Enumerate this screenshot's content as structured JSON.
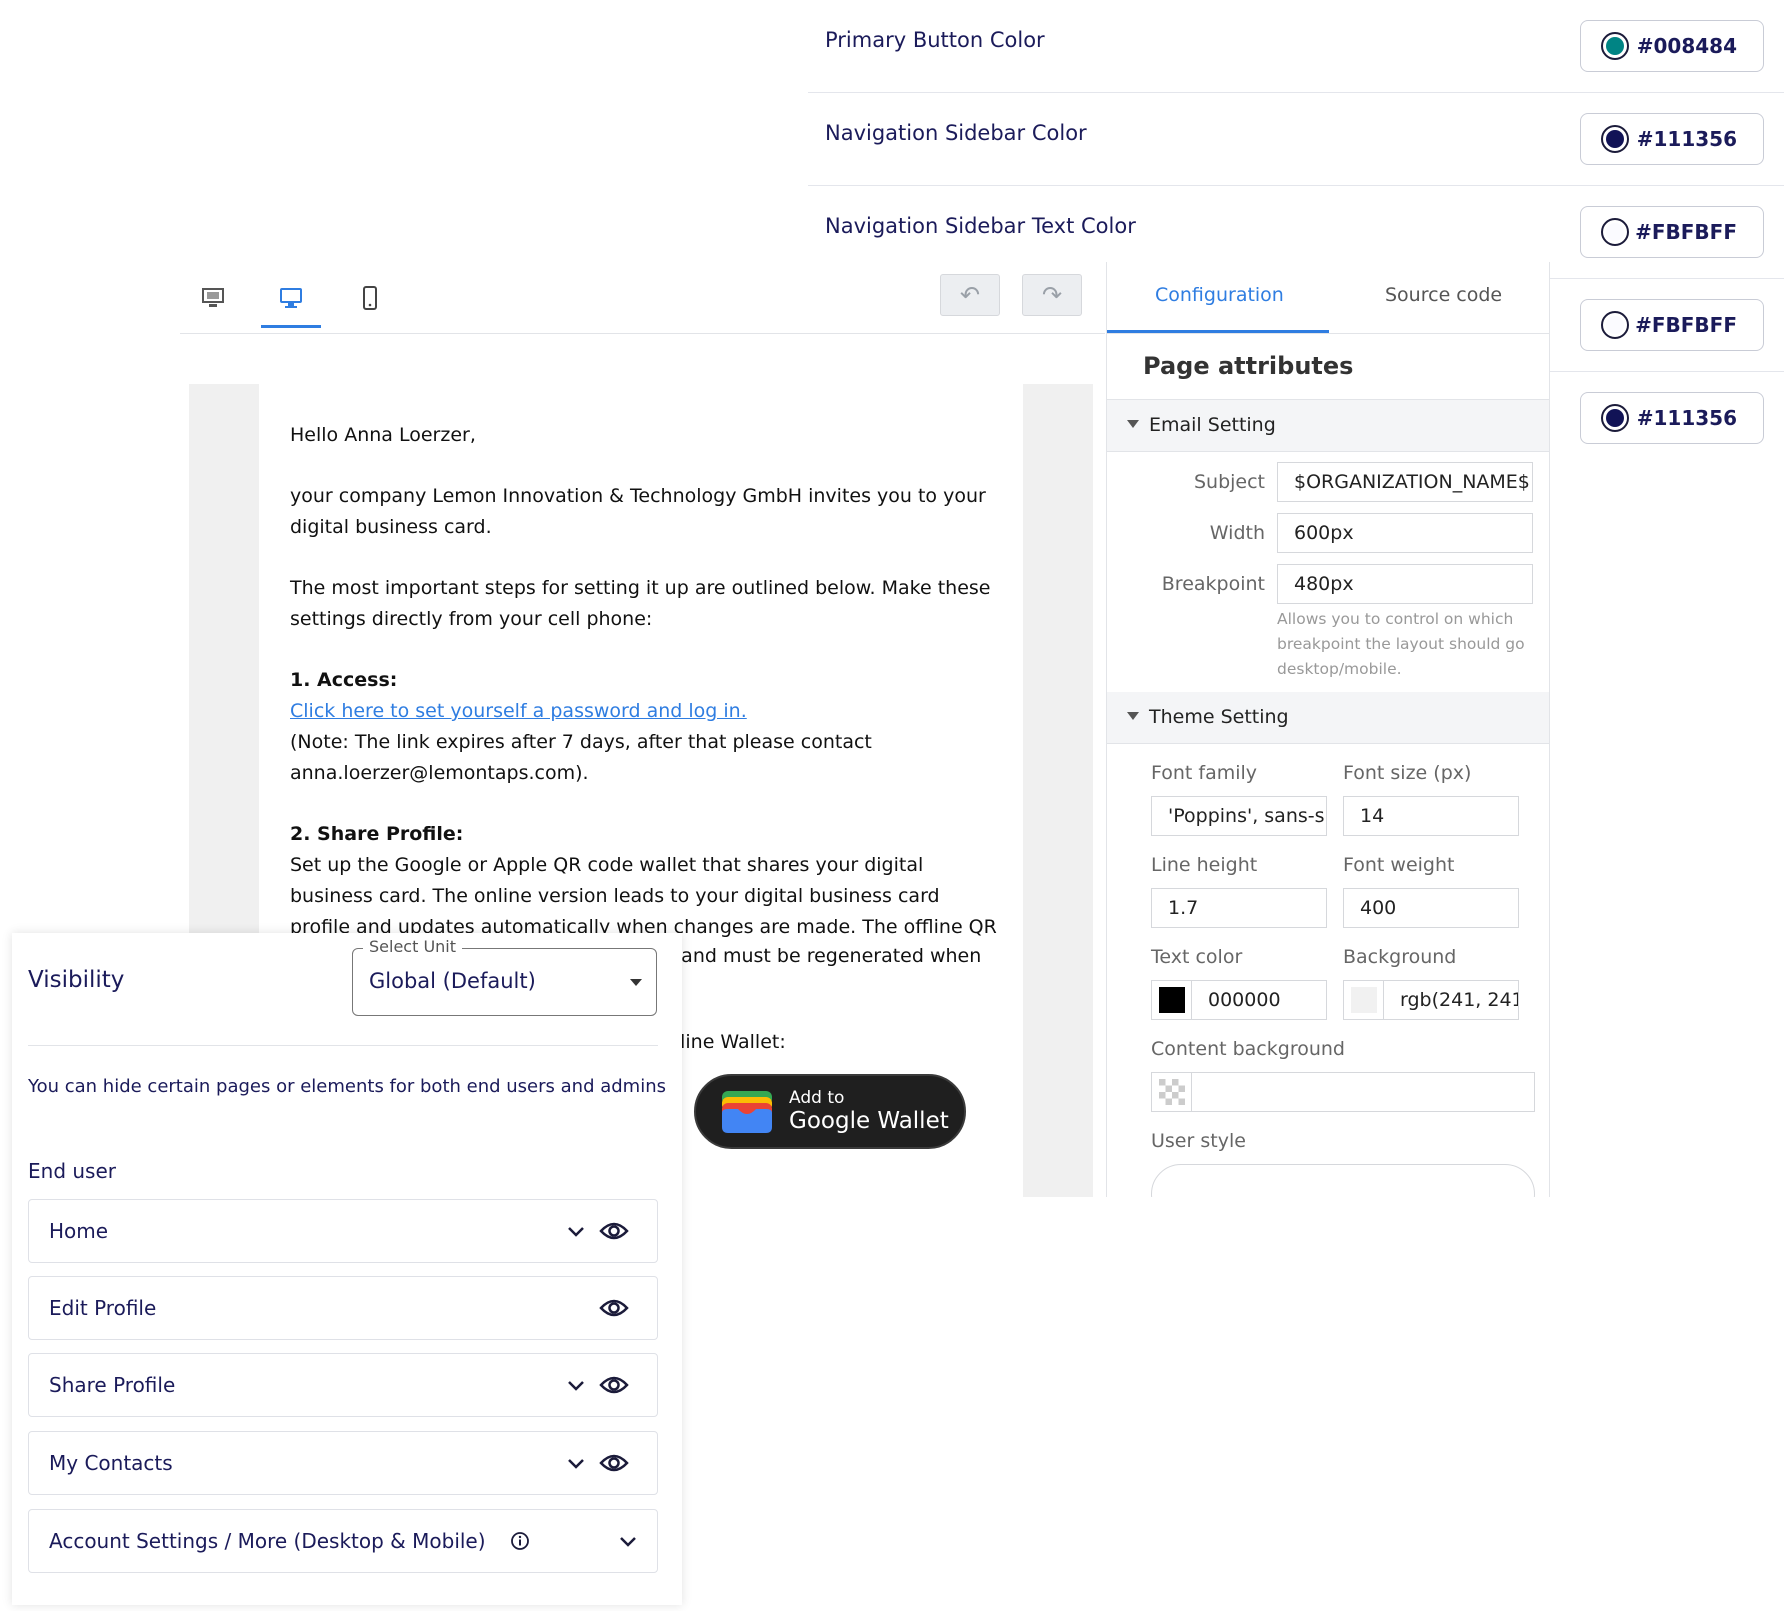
{
  "colors": {
    "rows": [
      {
        "label": "Primary Button Color",
        "hex": "#008484",
        "swatch": "#008484"
      },
      {
        "label": "Navigation Sidebar Color",
        "hex": "#111356",
        "swatch": "#111356"
      },
      {
        "label": "Navigation Sidebar Text Color",
        "hex": "#FBFBFF",
        "swatch": "#FBFBFF"
      },
      {
        "label": "",
        "hex": "#FBFBFF",
        "swatch": "#FBFBFF"
      },
      {
        "label": "",
        "hex": "#111356",
        "swatch": "#111356"
      }
    ]
  },
  "editor": {
    "toolbar": {
      "icons": [
        "monitor-settings-icon",
        "desktop-icon",
        "mobile-icon",
        "undo-icon",
        "redo-icon"
      ],
      "undo_label": "↶",
      "redo_label": "↷"
    },
    "email": {
      "greeting": "Hello Anna Loerzer,",
      "intro": "your company Lemon Innovation & Technology GmbH invites you to your digital business card.",
      "steps_intro": "The most important steps for setting it up are outlined below. Make these settings directly from your cell phone:",
      "access_heading": "1. Access:",
      "access_link": "Click here to set yourself a password and log in.",
      "access_note": "(Note: The link expires after 7 days, after that please contact anna.loerzer@lemontaps.com).",
      "share_heading": "2. Share Profile:",
      "share_text_1": "Set up the Google or Apple QR code wallet that shares your digital business card. The online version leads to your digital business card profile and updates automatically when changes are made. The offline QR code only",
      "share_text_2": "et and must be regenerated when",
      "offline_wallet": "ffline Wallet:",
      "wallet_line1": "Add to",
      "wallet_line2": "Google Wallet"
    },
    "config": {
      "tabs": [
        "Configuration",
        "Source code"
      ],
      "page_attributes": "Page attributes",
      "email_setting": {
        "title": "Email Setting",
        "subject_label": "Subject",
        "subject_value": "$ORGANIZATION_NAME$ ·",
        "width_label": "Width",
        "width_value": "600px",
        "breakpoint_label": "Breakpoint",
        "breakpoint_value": "480px",
        "breakpoint_help": "Allows you to control on which breakpoint the layout should go desktop/mobile."
      },
      "theme_setting": {
        "title": "Theme Setting",
        "font_family_label": "Font family",
        "font_family_value": "'Poppins', sans-s",
        "font_size_label": "Font size (px)",
        "font_size_value": "14",
        "line_height_label": "Line height",
        "line_height_value": "1.7",
        "font_weight_label": "Font weight",
        "font_weight_value": "400",
        "text_color_label": "Text color",
        "text_color_value": "000000",
        "text_color_swatch": "#000000",
        "background_label": "Background",
        "background_value": "rgb(241, 241",
        "background_swatch": "#f1f1f1",
        "content_bg_label": "Content background",
        "user_style_label": "User style"
      }
    }
  },
  "visibility": {
    "title": "Visibility",
    "select_legend": "Select Unit",
    "select_value": "Global (Default)",
    "description": "You can hide certain pages or elements for both end users and admins",
    "end_user_label": "End user",
    "items": [
      {
        "label": "Home",
        "chevron": true,
        "eye": true
      },
      {
        "label": "Edit Profile",
        "chevron": false,
        "eye": true
      },
      {
        "label": "Share Profile",
        "chevron": true,
        "eye": true
      },
      {
        "label": "My Contacts",
        "chevron": true,
        "eye": true
      },
      {
        "label": "Account Settings / More (Desktop & Mobile)",
        "chevron": true,
        "eye": false,
        "info": true
      }
    ]
  }
}
